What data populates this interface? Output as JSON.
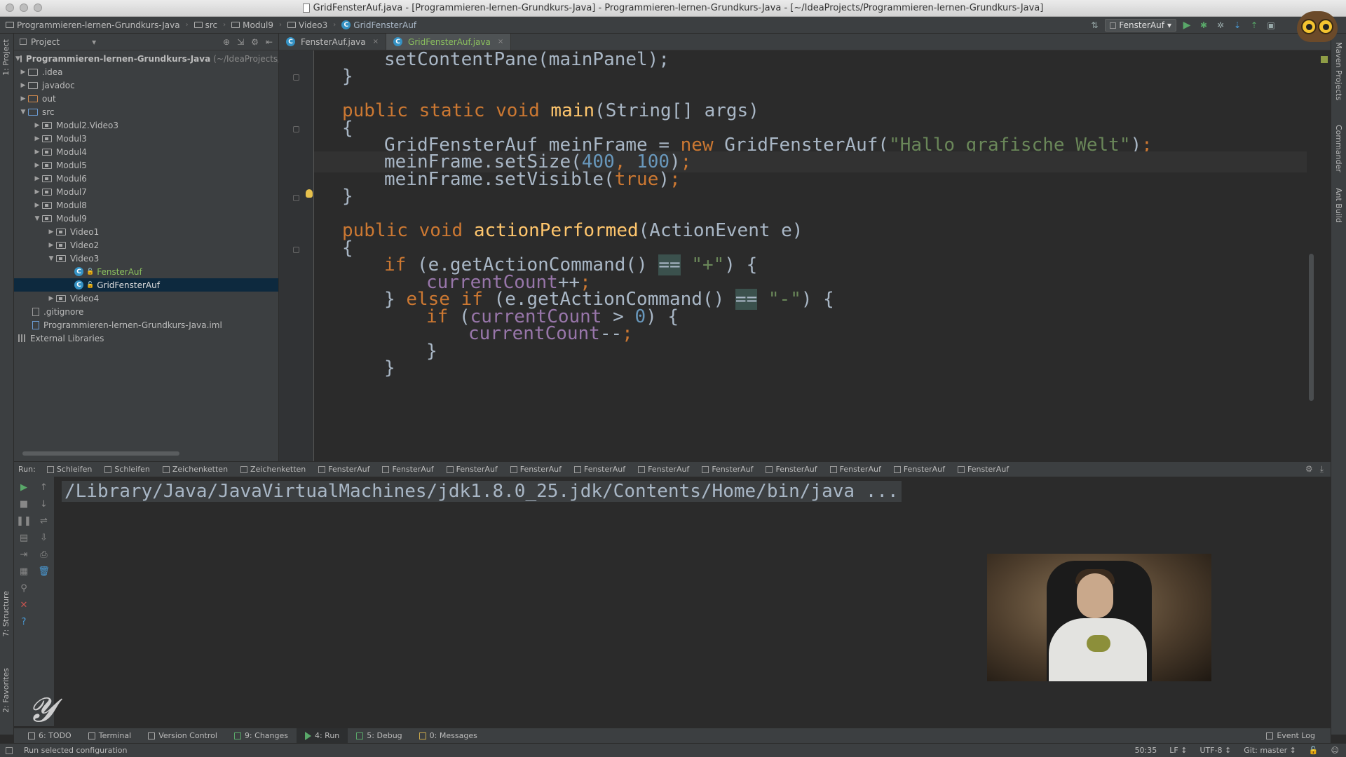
{
  "window": {
    "title": "GridFensterAuf.java - [Programmieren-lernen-Grundkurs-Java] - Programmieren-lernen-Grundkurs-Java - [~/IdeaProjects/Programmieren-lernen-Grundkurs-Java]"
  },
  "navbar": {
    "crumbs": [
      "Programmieren-lernen-Grundkurs-Java",
      "src",
      "Modul9",
      "Video3",
      "GridFensterAuf"
    ],
    "run_config": "FensterAuf"
  },
  "left_strip": {
    "project_tab": "1: Project",
    "structure_tab": "7: Structure",
    "favorites_tab": "2: Favorites"
  },
  "right_strip": {
    "maven_tab": "Maven Projects",
    "commander_tab": "Commander",
    "ant_tab": "Ant Build"
  },
  "project": {
    "header": "Project",
    "tree": [
      {
        "label": "Programmieren-lernen-Grundkurs-Java",
        "suffix": "(~/IdeaProjects/P"
      },
      {
        "label": ".idea"
      },
      {
        "label": "javadoc"
      },
      {
        "label": "out"
      },
      {
        "label": "src"
      },
      {
        "label": "Modul2.Video3"
      },
      {
        "label": "Modul3"
      },
      {
        "label": "Modul4"
      },
      {
        "label": "Modul5"
      },
      {
        "label": "Modul6"
      },
      {
        "label": "Modul7"
      },
      {
        "label": "Modul8"
      },
      {
        "label": "Modul9"
      },
      {
        "label": "Video1"
      },
      {
        "label": "Video2"
      },
      {
        "label": "Video3"
      },
      {
        "label": "FensterAuf"
      },
      {
        "label": "GridFensterAuf"
      },
      {
        "label": "Video4"
      },
      {
        "label": ".gitignore"
      },
      {
        "label": "Programmieren-lernen-Grundkurs-Java.iml"
      },
      {
        "label": "External Libraries"
      }
    ]
  },
  "editor": {
    "tabs": [
      "FensterAuf.java",
      "GridFensterAuf.java"
    ],
    "strings": {
      "hallo": "\"Hallo ",
      "grafische": "grafische",
      "welt": " Welt\"",
      "plus": "\"+\"",
      "minus": "\"-\""
    },
    "numbers": {
      "w": "400",
      "h": "100",
      "zero": "0"
    }
  },
  "run": {
    "label": "Run:",
    "tabs": [
      "Schleifen",
      "Schleifen",
      "Zeichenketten",
      "Zeichenketten",
      "FensterAuf",
      "FensterAuf",
      "FensterAuf",
      "FensterAuf",
      "FensterAuf",
      "FensterAuf",
      "FensterAuf",
      "FensterAuf",
      "FensterAuf",
      "FensterAuf",
      "FensterAuf"
    ],
    "console": "/Library/Java/JavaVirtualMachines/jdk1.8.0_25.jdk/Contents/Home/bin/java ..."
  },
  "toolwindows": {
    "todo": "6: TODO",
    "terminal": "Terminal",
    "vcs": "Version Control",
    "changes": "9: Changes",
    "run": "4: Run",
    "debug": "5: Debug",
    "messages": "0: Messages",
    "event_log": "Event Log"
  },
  "status": {
    "message": "Run selected configuration",
    "position": "50:35",
    "line_sep": "LF ↕",
    "encoding": "UTF-8 ↕",
    "git": "Git: master ↕"
  },
  "colors": {
    "keyword": "#cc7832",
    "method": "#ffc66d",
    "string": "#6a8759",
    "number": "#6897bb",
    "field": "#9876aa",
    "selection": "#0d293e"
  }
}
